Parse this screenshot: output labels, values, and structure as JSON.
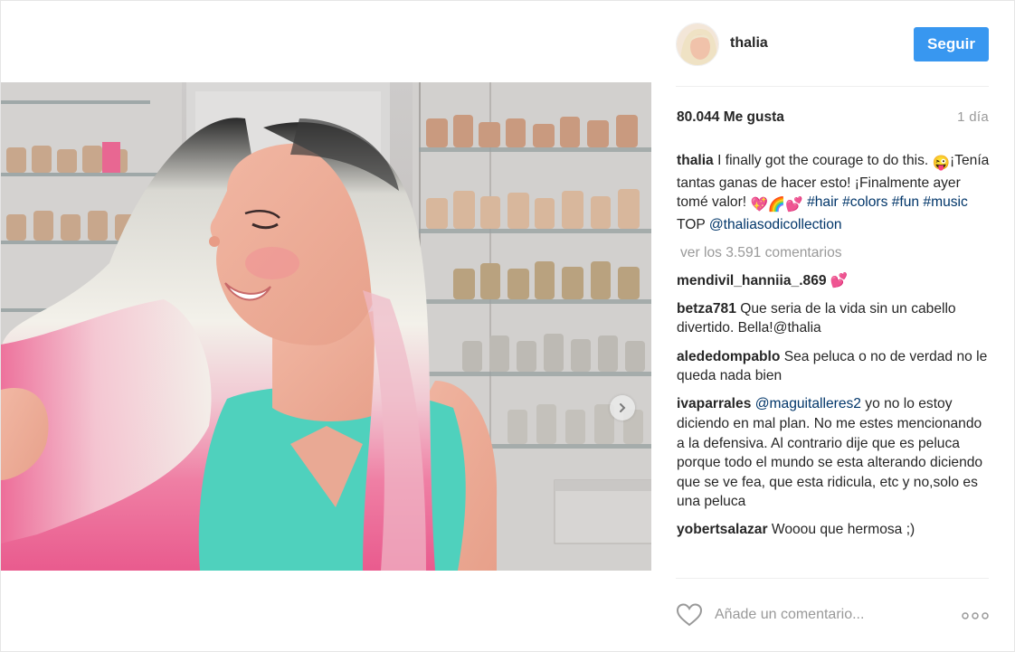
{
  "post": {
    "username": "thalia",
    "follow_label": "Seguir",
    "likes": "80.044 Me gusta",
    "time_ago": "1 día",
    "caption": {
      "username": "thalia",
      "text_1": " I finally got the courage to do this. ",
      "emoji_1": "😜",
      "text_2": "¡Tenía tantas ganas de hacer esto! ¡Finalmente ayer tomé valor! ",
      "emoji_2": "💖🌈💕",
      "tag_hair": "#hair",
      "tag_colors": "#colors",
      "tag_fun": "#fun",
      "tag_music": "#music",
      "text_3": " TOP ",
      "mention": "@thaliasodicollection"
    },
    "view_all_comments": "ver los 3.591 comentarios",
    "comments": [
      {
        "username": "mendivil_hanniia_.869",
        "text": " 💕"
      },
      {
        "username": "betza781",
        "text": " Que seria de la vida sin un cabello divertido. Bella!@thalia"
      },
      {
        "username": "alededompablo",
        "text": " Sea peluca o no de verdad no le queda nada bien"
      },
      {
        "username": "ivaparrales",
        "mention": "@maguitalleres2",
        "text": " yo no lo estoy diciendo en mal plan. No me estes mencionando a la defensiva. Al contrario dije que es peluca porque todo el mundo se esta alterando diciendo que se ve fea, que esta ridicula, etc y no,solo es una peluca"
      },
      {
        "username": "yobertsalazar",
        "text": " Wooou que hermosa ;)"
      }
    ],
    "comment_placeholder": "Añade un comentario..."
  },
  "icons": {
    "heart": "heart-icon",
    "more": "more-options-icon",
    "next": "chevron-right-icon"
  },
  "colors": {
    "follow_button": "#3897f0",
    "link": "#003569",
    "muted": "#999999"
  }
}
